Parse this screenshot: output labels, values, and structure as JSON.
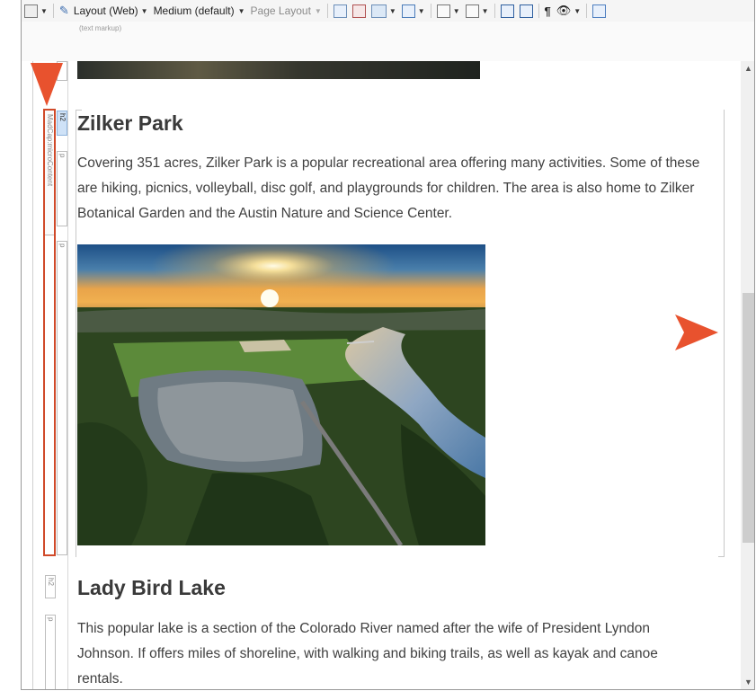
{
  "toolbar": {
    "layout_label": "Layout (Web)",
    "medium_label": "Medium (default)",
    "page_layout_label": "Page Layout",
    "show_tags_glyph": "¶"
  },
  "markup_bar": {
    "label": "(text markup)"
  },
  "gutter": {
    "div_tag_label": "MadCap:microContent",
    "tags": [
      "h2",
      "p",
      "p",
      "h2",
      "p"
    ]
  },
  "content": {
    "section1": {
      "heading": "Zilker Park",
      "paragraph": "Covering 351 acres, Zilker Park is a popular recreational area offering many activities. Some of these are hiking, picnics, volleyball, disc golf, and playgrounds for children. The area is also home to Zilker Botanical Garden and the Austin Nature and Science Center."
    },
    "section2": {
      "heading": "Lady Bird Lake",
      "paragraph": "This popular lake is a section of the Colorado River named after the wife of President Lyndon Johnson. If offers miles of shoreline, with walking and biking trails, as well as kayak and canoe rentals."
    }
  },
  "colors": {
    "arrow": "#e8522e",
    "highlight_box": "#d04a2a",
    "heading": "#3a3a3a",
    "text": "#404040"
  },
  "icons": [
    "zoom-icon",
    "preview-icon",
    "show-tags-icon",
    "insert-image-icon",
    "text-box-icon"
  ]
}
